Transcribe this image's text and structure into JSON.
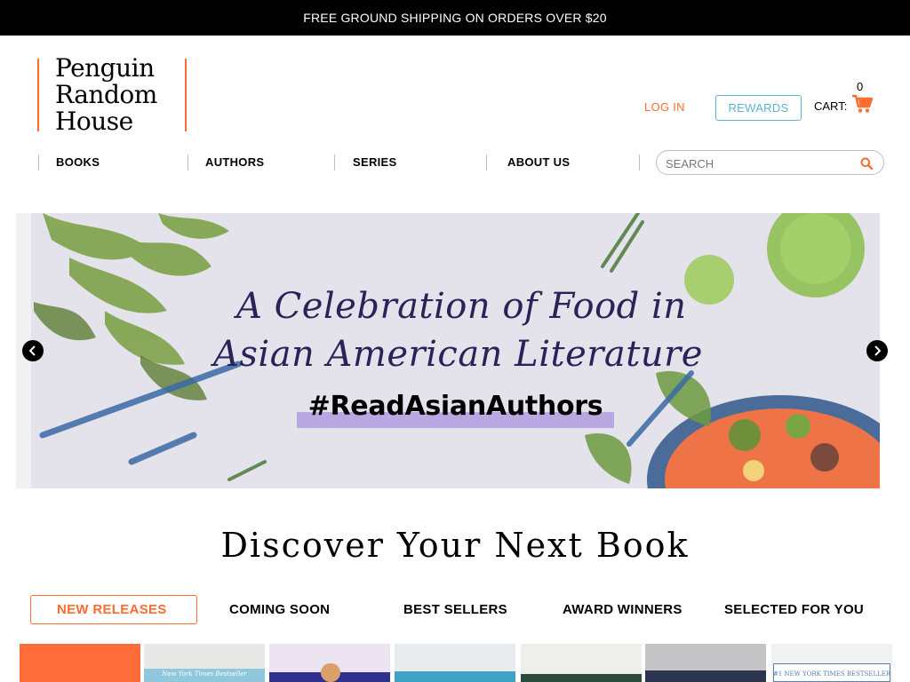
{
  "promo": {
    "text": "FREE GROUND SHIPPING ON ORDERS OVER $20"
  },
  "logo": {
    "line1": "Penguin",
    "line2": "Random",
    "line3": "House"
  },
  "utility": {
    "login": "LOG IN",
    "rewards": "REWARDS",
    "cart_label": "CART:",
    "cart_count": "0"
  },
  "nav": {
    "items": [
      {
        "label": "BOOKS"
      },
      {
        "label": "AUTHORS"
      },
      {
        "label": "SERIES"
      },
      {
        "label": "ABOUT US"
      }
    ]
  },
  "search": {
    "placeholder": "SEARCH"
  },
  "hero": {
    "line1": "A Celebration of Food in",
    "line2": "Asian American Literature",
    "hashtag": "#ReadAsianAuthors"
  },
  "discover": {
    "heading": "Discover Your Next Book"
  },
  "tabs": [
    {
      "label": "NEW RELEASES",
      "active": true
    },
    {
      "label": "COMING SOON",
      "active": false
    },
    {
      "label": "BEST SELLERS",
      "active": false
    },
    {
      "label": "AWARD WINNERS",
      "active": false
    },
    {
      "label": "SELECTED FOR YOU",
      "active": false
    }
  ],
  "books": {
    "cover_labels": {
      "nyt_bestseller_1": "New York Times Bestseller",
      "nyt_bestseller_2": "#1 NEW YORK TIMES BESTSELLER"
    }
  },
  "colors": {
    "accent": "#ff6c2f",
    "rewards": "#5bb4d4",
    "hero_text": "#2a2359",
    "hashtag_highlight": "#b8a7e0"
  }
}
